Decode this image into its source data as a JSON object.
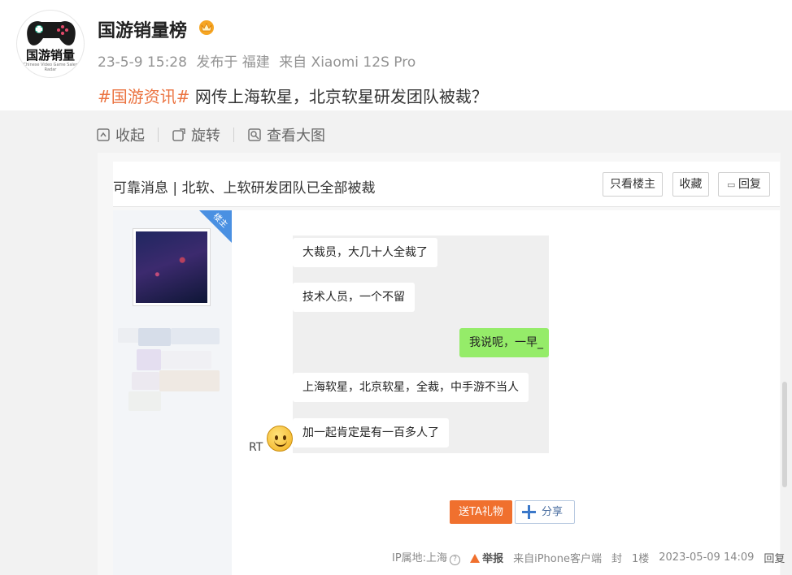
{
  "post": {
    "username": "国游销量榜",
    "avatar_text": "国游销量",
    "avatar_subtext": "Chinese Video Game Sales Radar",
    "meta": {
      "date": "23-5-9 15:28",
      "location": "发布于 福建",
      "device": "来自 Xiaomi 12S Pro"
    },
    "topic": "#国游资讯#",
    "text": " 网传上海软星，北京软星研发团队被裁？"
  },
  "image_tools": {
    "collapse": "收起",
    "rotate": "旋转",
    "view_large": "查看大图"
  },
  "forum": {
    "title": "可靠消息 | 北软、上软研发团队已全部被裁",
    "buttons": {
      "only_op": "只看楼主",
      "favorite": "收藏",
      "reply": "回复"
    },
    "op_tag": "楼主",
    "chat_messages": [
      {
        "text": "大裁员，大几十人全裁了",
        "side": "left"
      },
      {
        "text": "技术人员，一个不留",
        "side": "left"
      },
      {
        "text": "我说呢，一早_",
        "side": "right"
      },
      {
        "text": "上海软星，北京软星，全裁，中手游不当人",
        "side": "left"
      },
      {
        "text": "加一起肯定是有一百多人了",
        "side": "left"
      }
    ],
    "rt_label": "RT",
    "gift_button": "送TA礼物",
    "share_button": "分享",
    "footer": {
      "ip": "IP属地:上海",
      "report": "举报",
      "client": "来自iPhone客户端",
      "seal": "封",
      "floor": "1楼",
      "datetime": "2023-05-09 14:09",
      "reply": "回复"
    }
  },
  "colors": {
    "topic": "#eb7340",
    "meta": "#939393",
    "panel_bg": "#f2f2f2",
    "op_tag": "#4a90e2",
    "gift": "#f0702e",
    "chat_green": "#95ec69"
  }
}
